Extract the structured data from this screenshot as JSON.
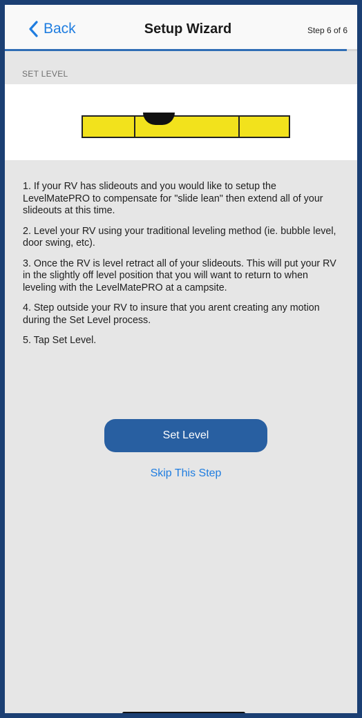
{
  "navbar": {
    "back_label": "Back",
    "title": "Setup Wizard",
    "step": "Step 6 of 6",
    "progress": 0.97,
    "accent_color": "#1f7de0"
  },
  "section": {
    "label": "SET LEVEL"
  },
  "level": {
    "bar_color": "#f2e21c",
    "bubble_icon": "level-bubble-icon"
  },
  "instructions": [
    "1. If your RV has slideouts and you would like to setup the LevelMatePRO to compensate for \"slide lean\" then extend all of your slideouts at this time.",
    "2. Level your RV using your traditional leveling method (ie. bubble level, door swing, etc).",
    "3. Once the RV is level retract all of your slideouts. This will put your RV in the slightly off level position that you will want to return to when leveling with the LevelMatePRO at a campsite.",
    "4. Step outside your RV to insure that you arent creating any motion during the Set Level process.",
    "5. Tap Set Level."
  ],
  "actions": {
    "primary_label": "Set Level",
    "primary_color": "#285fa1",
    "skip_label": "Skip This Step"
  }
}
